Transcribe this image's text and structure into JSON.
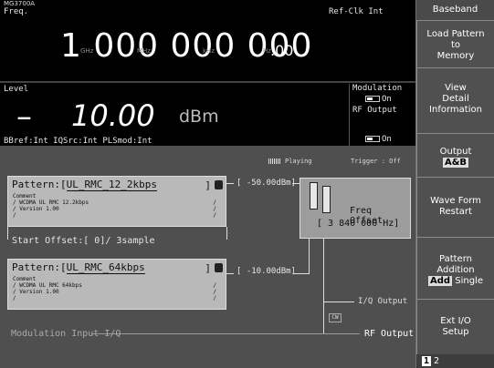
{
  "header": {
    "brand": "MG3700A",
    "freq_label": "Freq.",
    "ref_clk": "Ref-Clk Int"
  },
  "frequency": {
    "digits": "1 000 000 000",
    "decimal": ".00",
    "units": [
      "GHz",
      "MHz",
      "kHz",
      "Hz"
    ]
  },
  "level": {
    "label": "Level",
    "sign": "–",
    "value": "10.00",
    "unit": "dBm"
  },
  "status": {
    "modulation_label": "Modulation",
    "modulation_state": "On",
    "rf_output_label": "RF Output",
    "rf_output_state": "On",
    "line": "BBref:Int    IQSrc:Int   PLSmod:Int"
  },
  "playback": {
    "playing": "Playing",
    "trigger": "Trigger : Off"
  },
  "pattern_a": {
    "label": "Pattern:[",
    "name": "UL_RMC_12_2kbps",
    "end": "]",
    "comment": [
      "Comment",
      "/ WCDMA UL RMC 12.2kbps",
      "/ Version 1.00",
      "/"
    ],
    "power": "[ -50.00dBm]"
  },
  "start_offset": "Start Offset:[        0]/ 3sample",
  "pattern_b": {
    "label": "Pattern:[",
    "name": "UL_RMC_64kbps",
    "end": "]",
    "comment": [
      "Comment",
      "/ WCDMA UL RMC 64kbps",
      "/ Version 1.00",
      "/"
    ],
    "power": "[ -10.00dBm]"
  },
  "freq_offset": {
    "label": "Freq Offset",
    "value": "[   3 840 000 Hz]"
  },
  "outputs": {
    "mod_input": "Modulation Input I/Q",
    "iq_output": "I/Q Output",
    "rf_output": "RF Output",
    "cw": "CW"
  },
  "softkeys": {
    "title": "Baseband",
    "load_pattern": [
      "Load Pattern",
      "to",
      "Memory"
    ],
    "view_detail": [
      "View",
      "Detail",
      "Information"
    ],
    "output": "Output",
    "output_sel": "A&B",
    "wave_form": [
      "Wave Form",
      "Restart"
    ],
    "pattern_add": [
      "Pattern",
      "Addition"
    ],
    "pattern_add_sel": "Add",
    "pattern_add_alt": "Single",
    "ext_io": [
      "Ext I/O",
      "Setup"
    ],
    "page_current": "1",
    "page_total": "2"
  }
}
